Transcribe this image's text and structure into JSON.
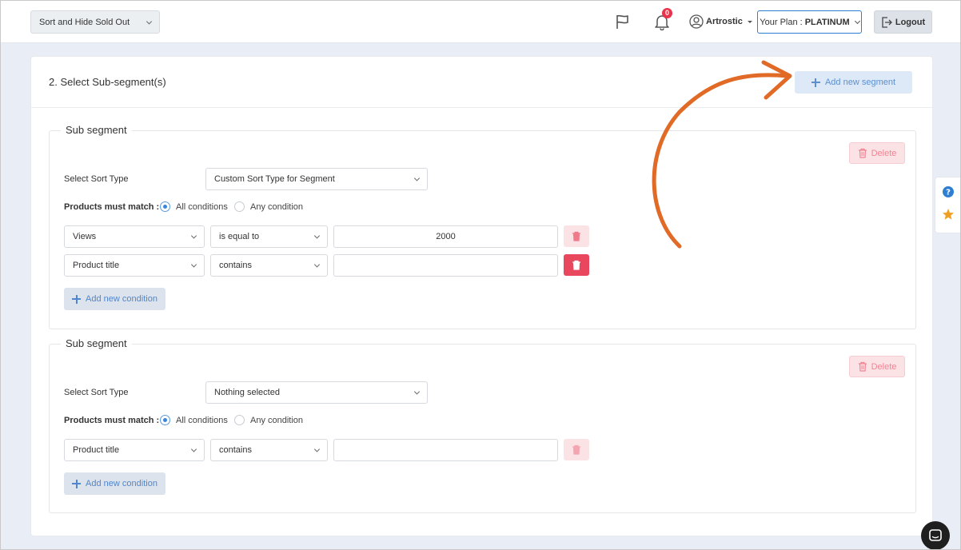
{
  "topbar": {
    "store_select": "Sort and Hide Sold Out",
    "notification_count": "0",
    "username": "Artrostic",
    "plan_prefix": "Your Plan :",
    "plan_name": "PLATINUM",
    "logout_label": "Logout"
  },
  "section": {
    "title": "2. Select Sub-segment(s)",
    "add_segment_label": "Add new segment"
  },
  "segments": [
    {
      "legend": "Sub segment",
      "delete_label": "Delete",
      "sort_type_label": "Select Sort Type",
      "sort_type_value": "Custom Sort Type for Segment",
      "match_label": "Products must match :",
      "match_all": "All conditions",
      "match_any": "Any condition",
      "match_selected": "all",
      "conditions": [
        {
          "field": "Views",
          "operator": "is equal to",
          "value": "2000"
        },
        {
          "field": "Product title",
          "operator": "contains",
          "value": ""
        }
      ],
      "add_condition_label": "Add new condition"
    },
    {
      "legend": "Sub segment",
      "delete_label": "Delete",
      "sort_type_label": "Select Sort Type",
      "sort_type_value": "Nothing selected",
      "match_label": "Products must match :",
      "match_all": "All conditions",
      "match_any": "Any condition",
      "match_selected": "all",
      "conditions": [
        {
          "field": "Product title",
          "operator": "contains",
          "value": ""
        }
      ],
      "add_condition_label": "Add new condition"
    }
  ],
  "colors": {
    "accent_blue": "#2f7fd1",
    "danger": "#e8475e",
    "annotation_arrow": "#e06a26",
    "star": "#f0a020"
  },
  "icons": [
    "flag-icon",
    "bell-icon",
    "user-circle-icon",
    "logout-icon",
    "plus-icon",
    "trash-icon",
    "help-icon",
    "star-icon",
    "chat-icon"
  ]
}
